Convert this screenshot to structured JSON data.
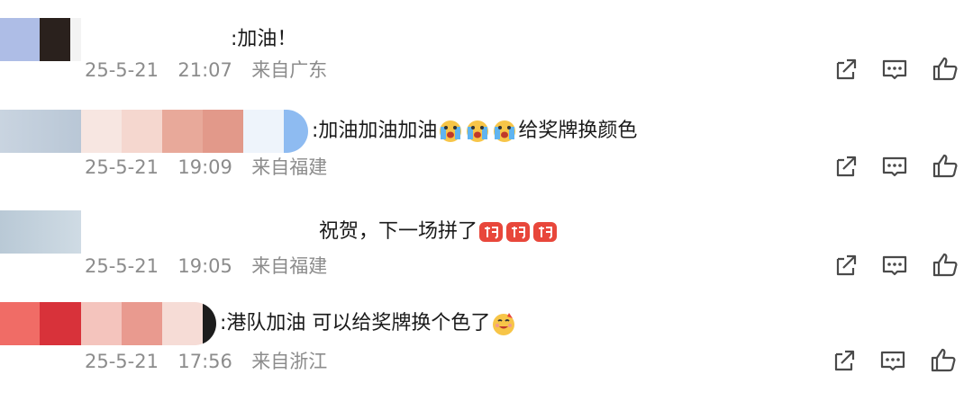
{
  "comments": [
    {
      "text": ":加油！",
      "date": "25-5-21",
      "time": "21:07",
      "location": "来自广东",
      "emojis": []
    },
    {
      "text": ":加油加油加油",
      "text_after": "给奖牌换颜色",
      "date": "25-5-21",
      "time": "19:09",
      "location": "来自福建",
      "emojis": [
        "crying-face-icon",
        "crying-face-icon",
        "crying-face-icon"
      ]
    },
    {
      "text": "祝贺，下一场拼了",
      "date": "25-5-21",
      "time": "19:05",
      "location": "来自福建",
      "emojis": [
        "jiayou-badge-icon",
        "jiayou-badge-icon",
        "jiayou-badge-icon"
      ]
    },
    {
      "text": ":港队加油 可以给奖牌换个色了",
      "date": "25-5-21",
      "time": "17:56",
      "location": "来自浙江",
      "emojis": [
        "party-face-icon"
      ]
    }
  ],
  "icons": {
    "share": "share-icon",
    "reply": "reply-icon",
    "like": "like-icon"
  },
  "colors": {
    "text": "#1a1a1a",
    "meta": "#8c8c8c",
    "icon": "#4a4a4a"
  }
}
